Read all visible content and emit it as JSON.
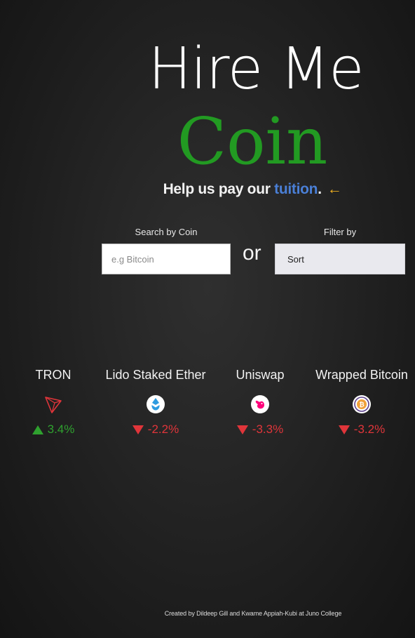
{
  "header": {
    "title": "Hire Me",
    "subtitle": "Coin",
    "tagline_prefix": "Help us pay our ",
    "tagline_link": "tuition",
    "tagline_suffix": ".",
    "arrow_icon": "arrow-left-icon"
  },
  "search": {
    "label": "Search by Coin",
    "placeholder": "e.g Bitcoin",
    "value": ""
  },
  "separator": "or",
  "filter": {
    "label": "Filter by",
    "selected": "Sort"
  },
  "coins": [
    {
      "name": "TRON",
      "icon": "tron-icon",
      "change": "3.4%",
      "direction": "up"
    },
    {
      "name": "Lido Staked Ether",
      "icon": "lido-icon",
      "change": "-2.2%",
      "direction": "down"
    },
    {
      "name": "Uniswap",
      "icon": "uniswap-icon",
      "change": "-3.3%",
      "direction": "down"
    },
    {
      "name": "Wrapped Bitcoin",
      "icon": "wrapped-bitcoin-icon",
      "change": "-3.2%",
      "direction": "down"
    }
  ],
  "colors": {
    "coin_green": "#229a22",
    "link_blue": "#4a7fd6",
    "arrow_yellow": "#f0b020",
    "up_green": "#2fa12f",
    "down_red": "#e0353a"
  },
  "footer": {
    "credit": "Created by Dildeep Gill and Kwame Appiah-Kubi at Juno College"
  }
}
